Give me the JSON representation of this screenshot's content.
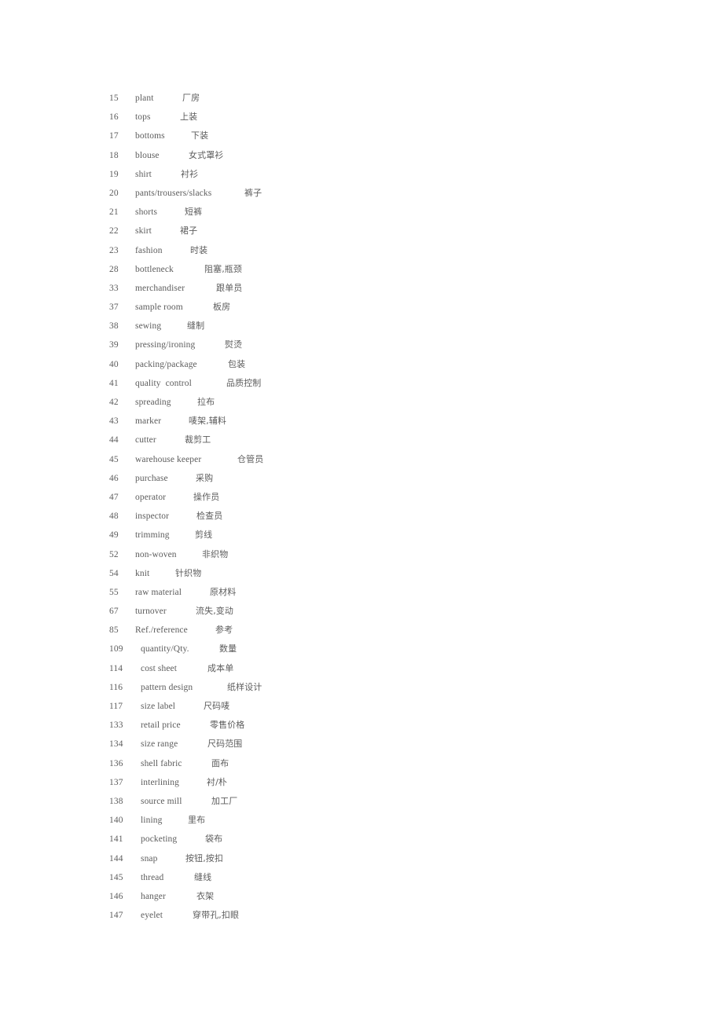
{
  "document": {
    "type": "bilingual-glossary",
    "language_pair": "English-Chinese",
    "text_color": "#5d5d5d",
    "background_color": "#ffffff",
    "entry_count": 40
  },
  "entries": [
    {
      "num": "15",
      "term": "plant",
      "gloss": "厂房",
      "term_width": 38,
      "gloss_gap": 22
    },
    {
      "num": "16",
      "term": "tops",
      "gloss": "上装",
      "term_width": 32,
      "gloss_gap": 25
    },
    {
      "num": "17",
      "term": "bottoms",
      "gloss": "下装",
      "term_width": 49,
      "gloss_gap": 22
    },
    {
      "num": "18",
      "term": "blouse",
      "gloss": "女式罩衫",
      "term_width": 42,
      "gloss_gap": 26
    },
    {
      "num": "19",
      "term": "shirt",
      "gloss": "衬衫",
      "term_width": 30,
      "gloss_gap": 28
    },
    {
      "num": "20",
      "term": "pants/trousers/slacks",
      "gloss": "裤子",
      "term_width": 116,
      "gloss_gap": 23
    },
    {
      "num": "21",
      "term": "shorts",
      "gloss": "短裤",
      "term_width": 38,
      "gloss_gap": 25
    },
    {
      "num": "22",
      "term": "skirt",
      "gloss": "裙子",
      "term_width": 30,
      "gloss_gap": 27
    },
    {
      "num": "23",
      "term": "fashion",
      "gloss": "时装",
      "term_width": 45,
      "gloss_gap": 25
    },
    {
      "num": "28",
      "term": "bottleneck",
      "gloss": "阻塞,瓶颈",
      "term_width": 62,
      "gloss_gap": 26
    },
    {
      "num": "33",
      "term": "merchandiser",
      "gloss": "跟单员",
      "term_width": 73,
      "gloss_gap": 30
    },
    {
      "num": "37",
      "term": "sample room",
      "gloss": "板房",
      "term_width": 71,
      "gloss_gap": 28
    },
    {
      "num": "38",
      "term": "sewing",
      "gloss": "缝制",
      "term_width": 41,
      "gloss_gap": 25
    },
    {
      "num": "39",
      "term": "pressing/ironing",
      "gloss": "熨烫",
      "term_width": 86,
      "gloss_gap": 28
    },
    {
      "num": "40",
      "term": "packing/package",
      "gloss": "包装",
      "term_width": 88,
      "gloss_gap": 30
    },
    {
      "num": "41",
      "term": "quality  control",
      "gloss": "品质控制",
      "term_width": 85,
      "gloss_gap": 31
    },
    {
      "num": "42",
      "term": "spreading",
      "gloss": "拉布",
      "term_width": 53,
      "gloss_gap": 26
    },
    {
      "num": "43",
      "term": "marker",
      "gloss": "唛架,辅料",
      "term_width": 39,
      "gloss_gap": 29
    },
    {
      "num": "44",
      "term": "cutter",
      "gloss": "裁剪工",
      "term_width": 35,
      "gloss_gap": 28
    },
    {
      "num": "45",
      "term": "warehouse keeper",
      "gloss": "仓管员",
      "term_width": 99,
      "gloss_gap": 31
    },
    {
      "num": "46",
      "term": "purchase",
      "gloss": "采购",
      "term_width": 50,
      "gloss_gap": 27
    },
    {
      "num": "47",
      "term": "operator",
      "gloss": "操作员",
      "term_width": 46,
      "gloss_gap": 28
    },
    {
      "num": "48",
      "term": "inspector",
      "gloss": "检查员",
      "term_width": 49,
      "gloss_gap": 29
    },
    {
      "num": "49",
      "term": "trimming",
      "gloss": "剪线",
      "term_width": 49,
      "gloss_gap": 27
    },
    {
      "num": "52",
      "term": "non-woven",
      "gloss": "非织物",
      "term_width": 57,
      "gloss_gap": 28
    },
    {
      "num": "54",
      "term": "knit",
      "gloss": "针织物",
      "term_width": 24,
      "gloss_gap": 27
    },
    {
      "num": "55",
      "term": "raw material",
      "gloss": "原材料",
      "term_width": 66,
      "gloss_gap": 29
    },
    {
      "num": "67",
      "term": "turnover",
      "gloss": "流失,变动",
      "term_width": 49,
      "gloss_gap": 28
    },
    {
      "num": "85",
      "term": "Ref./reference",
      "gloss": "参考",
      "term_width": 74,
      "gloss_gap": 28
    },
    {
      "num": "109",
      "term": "quantity/Qty.",
      "gloss": "数量",
      "term_width": 71,
      "gloss_gap": 29
    },
    {
      "num": "114",
      "term": "cost sheet",
      "gloss": "成本单",
      "term_width": 57,
      "gloss_gap": 28
    },
    {
      "num": "116",
      "term": "pattern design",
      "gloss": "纸样设计",
      "term_width": 80,
      "gloss_gap": 30
    },
    {
      "num": "117",
      "term": "size label",
      "gloss": "尺码唛",
      "term_width": 51,
      "gloss_gap": 29
    },
    {
      "num": "133",
      "term": "retail price",
      "gloss": "零售价格",
      "term_width": 57,
      "gloss_gap": 31
    },
    {
      "num": "134",
      "term": "size range",
      "gloss": "尺码范围",
      "term_width": 56,
      "gloss_gap": 29
    },
    {
      "num": "136",
      "term": "shell fabric",
      "gloss": "面布",
      "term_width": 62,
      "gloss_gap": 28
    },
    {
      "num": "137",
      "term": "interlining",
      "gloss": "衬/朴",
      "term_width": 55,
      "gloss_gap": 29
    },
    {
      "num": "138",
      "term": "source mill",
      "gloss": "加工厂",
      "term_width": 62,
      "gloss_gap": 28
    },
    {
      "num": "140",
      "term": "lining",
      "gloss": "里布",
      "term_width": 32,
      "gloss_gap": 28
    },
    {
      "num": "141",
      "term": "pocketing",
      "gloss": "袋布",
      "term_width": 55,
      "gloss_gap": 27
    },
    {
      "num": "144",
      "term": "snap",
      "gloss": "按钮,按扣",
      "term_width": 29,
      "gloss_gap": 28
    },
    {
      "num": "145",
      "term": "thread",
      "gloss": "缝线",
      "term_width": 39,
      "gloss_gap": 29
    },
    {
      "num": "146",
      "term": "hanger",
      "gloss": "衣架",
      "term_width": 41,
      "gloss_gap": 30
    },
    {
      "num": "147",
      "term": "eyelet",
      "gloss": "穿带孔,扣眼",
      "term_width": 37,
      "gloss_gap": 29
    }
  ]
}
